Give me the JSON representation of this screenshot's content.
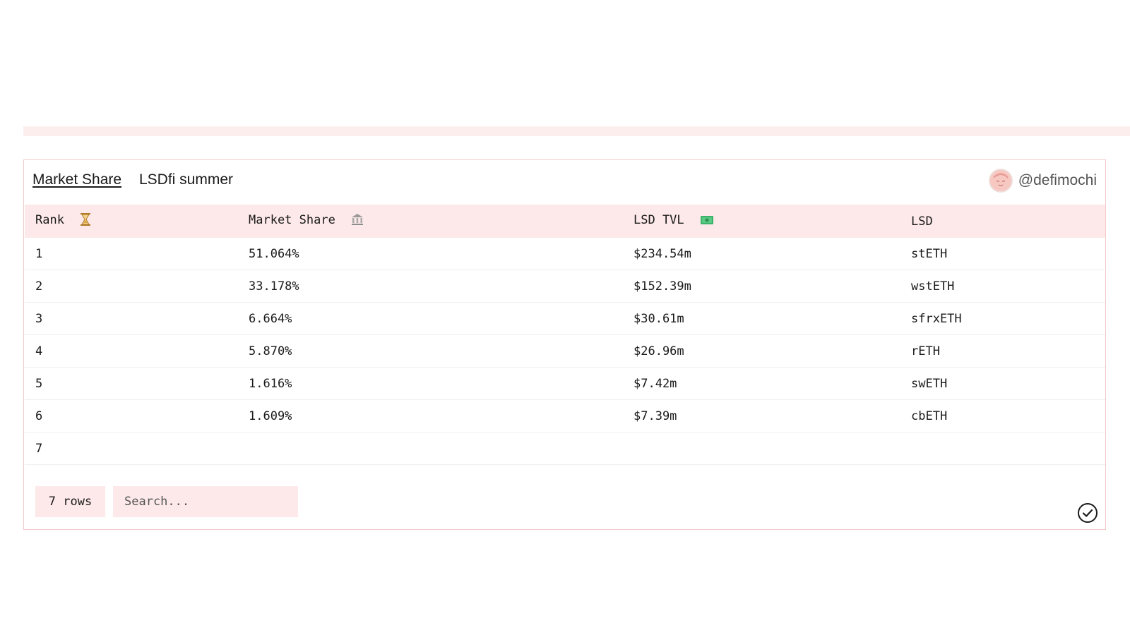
{
  "header": {
    "active_tab": "Market Share",
    "secondary_tab": "LSDfi summer",
    "author": "@defimochi"
  },
  "table": {
    "columns": [
      {
        "label": "Rank",
        "icon": "hourglass-icon"
      },
      {
        "label": "Market Share",
        "icon": "bank-icon"
      },
      {
        "label": "LSD TVL",
        "icon": "money-icon"
      },
      {
        "label": "LSD",
        "icon": ""
      }
    ],
    "rows": [
      {
        "rank": "1",
        "share": "51.064%",
        "tvl": "$234.54m",
        "lsd": "stETH"
      },
      {
        "rank": "2",
        "share": "33.178%",
        "tvl": "$152.39m",
        "lsd": "wstETH"
      },
      {
        "rank": "3",
        "share": "6.664%",
        "tvl": "$30.61m",
        "lsd": "sfrxETH"
      },
      {
        "rank": "4",
        "share": "5.870%",
        "tvl": "$26.96m",
        "lsd": "rETH"
      },
      {
        "rank": "5",
        "share": "1.616%",
        "tvl": "$7.42m",
        "lsd": "swETH"
      },
      {
        "rank": "6",
        "share": "1.609%",
        "tvl": "$7.39m",
        "lsd": "cbETH"
      },
      {
        "rank": "7",
        "share": "",
        "tvl": "",
        "lsd": ""
      }
    ]
  },
  "footer": {
    "row_count": "7 rows",
    "search_placeholder": "Search..."
  },
  "colors": {
    "header_row_bg": "#fde9e9",
    "card_border": "#f1c9c9",
    "band": "#fdeeee"
  }
}
